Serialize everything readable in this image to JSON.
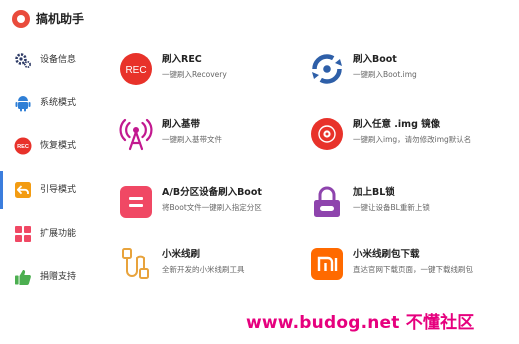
{
  "app": {
    "title": "搞机助手"
  },
  "sidebar": {
    "items": [
      {
        "label": "设备信息",
        "icon": "gear-icon"
      },
      {
        "label": "系统模式",
        "icon": "android-icon"
      },
      {
        "label": "恢复模式",
        "icon": "rec-icon"
      },
      {
        "label": "引导模式",
        "icon": "boot-arrow-icon"
      },
      {
        "label": "扩展功能",
        "icon": "grid-icon"
      },
      {
        "label": "捐赠支持",
        "icon": "thumbs-up-icon"
      }
    ],
    "active_index": 3
  },
  "cards": [
    {
      "title": "刷入REC",
      "desc": "一键刷入Recovery",
      "icon": "rec-icon"
    },
    {
      "title": "刷入Boot",
      "desc": "一键刷入Boot.img",
      "icon": "boot-disc-icon"
    },
    {
      "title": "刷入基带",
      "desc": "一键刷入基带文件",
      "icon": "antenna-icon"
    },
    {
      "title": "刷入任意 .img 镜像",
      "desc": "一键刷入img，请勿修改img默认名",
      "icon": "disc-icon"
    },
    {
      "title": "A/B分区设备刷入Boot",
      "desc": "将Boot文件一键刷入指定分区",
      "icon": "partition-icon"
    },
    {
      "title": "加上BL锁",
      "desc": "一键让设备BL重新上锁",
      "icon": "lock-icon"
    },
    {
      "title": "小米线刷",
      "desc": "全新开发的小米线刷工具",
      "icon": "usb-cable-icon"
    },
    {
      "title": "小米线刷包下载",
      "desc": "直达官网下载页面，一键下载线刷包",
      "icon": "mi-logo-icon"
    }
  ],
  "watermark": {
    "text": "www.budog.net 不懂社区"
  },
  "colors": {
    "red": "#e8322a",
    "blue": "#2e5fa8",
    "magenta": "#c2188f",
    "purple": "#8e44ad",
    "orange": "#ff6a00",
    "pink": "#f04864",
    "green": "#4caf50",
    "accent": "#3b7ddd"
  }
}
